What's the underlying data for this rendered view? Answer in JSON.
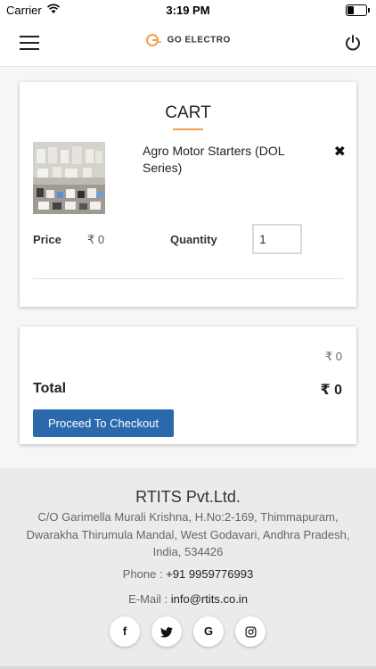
{
  "status_bar": {
    "carrier": "Carrier",
    "time": "3:19 PM"
  },
  "header": {
    "logo_text": "GO ELECTRO",
    "logo_mark": "G"
  },
  "cart": {
    "title": "CART",
    "product_name": "Agro Motor Starters (DOL Series)",
    "remove_symbol": "✖",
    "price_label": "Price",
    "price_value": "₹ 0",
    "quantity_label": "Quantity",
    "quantity_value": "1"
  },
  "totals": {
    "subtotal_value": "₹ 0",
    "total_label": "Total",
    "total_value": "₹ 0",
    "checkout_label": "Proceed To Checkout"
  },
  "footer": {
    "company": "RTITS Pvt.Ltd.",
    "address": "C/O Garimella Murali Krishna, H.No:2-169, Thimmapuram, Dwarakha Thirumula Mandal, West Godavari, Andhra Pradesh, India, 534426",
    "phone_label": "Phone : ",
    "phone_value": "+91 9959776993",
    "email_label": "E-Mail : ",
    "email_value": "info@rtits.co.in",
    "socials": [
      {
        "icon": "facebook-icon",
        "glyph": "f"
      },
      {
        "icon": "twitter-icon",
        "glyph": "t"
      },
      {
        "icon": "google-icon",
        "glyph": "G"
      },
      {
        "icon": "instagram-icon",
        "glyph": "◎"
      }
    ]
  },
  "colors": {
    "accent": "#2b69ad",
    "underline": "#f0a050",
    "footer_bg": "#ebebeb"
  }
}
